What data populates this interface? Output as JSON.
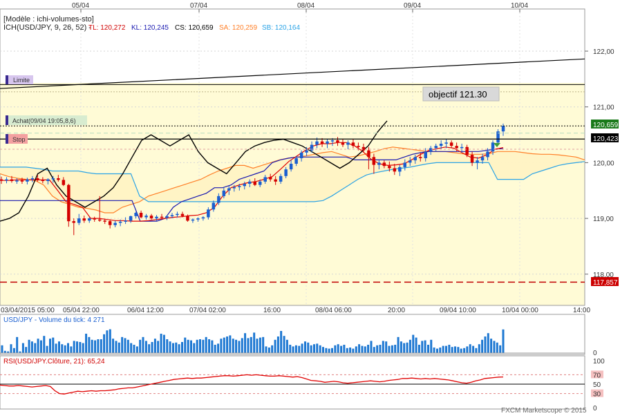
{
  "colors": {
    "background_main": "#fffbd6",
    "cloud_fill": "#fff3c4",
    "tenkan": "#e00000",
    "kijun": "#1818b0",
    "chikou": "#000000",
    "senkou_a": "#ff7f27",
    "senkou_b": "#2aa3e6",
    "candle_up": "#1a5fd0",
    "candle_down": "#d40000",
    "volume": "#1e78d2",
    "rsi": "#e00000",
    "stop_line": "#c00000"
  },
  "header": {
    "model_line": "[Modèle : ichi-volumes-sto]",
    "ich_label": "ICH(USD/JPY, 9, 26, 52) -",
    "tl": "TL: 120,272",
    "kl": "KL: 120,245",
    "cs": "CS: 120,659",
    "sa": "SA: 120,259",
    "sb": "SB: 120,164"
  },
  "top_dates": [
    "05/04",
    "07/04",
    "08/04",
    "09/04",
    "10/04"
  ],
  "bottom_axis": [
    "03/04/2015 05:00",
    "05/04 22:00",
    "06/04 12:00",
    "07/04 02:00",
    "16:00",
    "08/04 06:00",
    "20:00",
    "09/04 10:00",
    "10/04 00:00",
    "14:00"
  ],
  "price_axis": [
    "122,00",
    "121,00",
    "120,00",
    "119,00",
    "118,00"
  ],
  "badges": {
    "current": "120,659",
    "entry": "120,423",
    "stop": "117,857"
  },
  "markers": {
    "limit": "Limite",
    "buy": "Achat(09/04 19:05,8,6)",
    "stop": "Stop"
  },
  "annotation": "objectif 121.30",
  "volume_panel": {
    "title": "USD/JPY - Volume du tick: 4 271",
    "zero_label": "0"
  },
  "rsi_panel": {
    "title": "RSI(USD/JPY.Clôture, 21): 65,24",
    "axis": [
      "100",
      "70",
      "50",
      "30",
      "0"
    ]
  },
  "copyright": "FXCM Marketscope © 2015",
  "chart_data": [
    {
      "type": "candlestick",
      "title": "ICH(USD/JPY, 9, 26, 52)",
      "ylim": [
        117.6,
        122.7
      ],
      "ohlc": [
        [
          119.7,
          119.75,
          119.62,
          119.68
        ],
        [
          119.68,
          119.74,
          119.63,
          119.7
        ],
        [
          119.7,
          119.76,
          119.64,
          119.67
        ],
        [
          119.67,
          119.72,
          119.62,
          119.68
        ],
        [
          119.68,
          119.73,
          119.62,
          119.66
        ],
        [
          119.66,
          119.73,
          119.61,
          119.7
        ],
        [
          119.7,
          119.76,
          119.65,
          119.72
        ],
        [
          119.72,
          119.78,
          119.66,
          119.69
        ],
        [
          119.69,
          119.74,
          119.63,
          119.67
        ],
        [
          119.67,
          119.72,
          119.61,
          119.7
        ],
        [
          119.7,
          119.76,
          119.64,
          119.72
        ],
        [
          119.72,
          119.78,
          119.66,
          119.69
        ],
        [
          119.69,
          119.74,
          119.58,
          119.6
        ],
        [
          119.6,
          119.62,
          118.85,
          118.95
        ],
        [
          118.95,
          119.0,
          118.7,
          118.92
        ],
        [
          118.92,
          119.08,
          118.88,
          119.0
        ],
        [
          119.0,
          119.05,
          118.92,
          118.96
        ],
        [
          118.96,
          119.02,
          118.92,
          119.0
        ],
        [
          119.0,
          119.03,
          118.94,
          118.98
        ],
        [
          118.98,
          119.4,
          118.94,
          118.96
        ],
        [
          118.96,
          118.99,
          118.9,
          118.95
        ],
        [
          118.95,
          118.98,
          118.82,
          118.88
        ],
        [
          118.88,
          118.96,
          118.84,
          118.92
        ],
        [
          118.92,
          118.98,
          118.86,
          118.94
        ],
        [
          118.94,
          119.02,
          118.9,
          118.96
        ],
        [
          118.96,
          119.05,
          118.92,
          119.04
        ],
        [
          119.04,
          119.12,
          119.0,
          119.1
        ],
        [
          119.1,
          119.14,
          119.0,
          119.02
        ],
        [
          119.02,
          119.08,
          118.98,
          119.05
        ],
        [
          119.05,
          119.08,
          118.98,
          119.0
        ],
        [
          119.0,
          119.06,
          118.96,
          119.03
        ],
        [
          119.03,
          119.08,
          118.98,
          119.01
        ],
        [
          119.01,
          119.06,
          118.97,
          119.04
        ],
        [
          119.04,
          119.1,
          119.0,
          119.06
        ],
        [
          119.06,
          119.12,
          119.02,
          119.08
        ],
        [
          119.08,
          119.12,
          119.02,
          119.04
        ],
        [
          119.04,
          119.07,
          118.94,
          118.96
        ],
        [
          118.96,
          119.0,
          118.92,
          118.98
        ],
        [
          118.98,
          119.02,
          118.94,
          119.0
        ],
        [
          119.0,
          119.04,
          118.96,
          119.02
        ],
        [
          119.02,
          119.2,
          118.98,
          119.16
        ],
        [
          119.16,
          119.32,
          119.12,
          119.28
        ],
        [
          119.28,
          119.45,
          119.24,
          119.4
        ],
        [
          119.4,
          119.56,
          119.36,
          119.5
        ],
        [
          119.5,
          119.58,
          119.42,
          119.54
        ],
        [
          119.54,
          119.6,
          119.48,
          119.56
        ],
        [
          119.56,
          119.62,
          119.5,
          119.58
        ],
        [
          119.58,
          119.66,
          119.52,
          119.62
        ],
        [
          119.62,
          119.7,
          119.56,
          119.66
        ],
        [
          119.66,
          119.72,
          119.58,
          119.6
        ],
        [
          119.6,
          119.7,
          119.56,
          119.66
        ],
        [
          119.66,
          119.78,
          119.62,
          119.74
        ],
        [
          119.74,
          119.8,
          119.66,
          119.7
        ],
        [
          119.7,
          119.76,
          119.6,
          119.66
        ],
        [
          119.66,
          119.8,
          119.62,
          119.76
        ],
        [
          119.76,
          119.92,
          119.72,
          119.88
        ],
        [
          119.88,
          120.05,
          119.84,
          119.98
        ],
        [
          119.98,
          120.12,
          119.94,
          120.08
        ],
        [
          120.08,
          120.22,
          120.02,
          120.18
        ],
        [
          120.18,
          120.28,
          120.12,
          120.22
        ],
        [
          120.22,
          120.38,
          120.18,
          120.32
        ],
        [
          120.32,
          120.45,
          120.26,
          120.38
        ],
        [
          120.38,
          120.44,
          120.28,
          120.34
        ],
        [
          120.34,
          120.42,
          120.26,
          120.38
        ],
        [
          120.38,
          120.44,
          120.3,
          120.4
        ],
        [
          120.4,
          120.46,
          120.3,
          120.36
        ],
        [
          120.36,
          120.42,
          120.28,
          120.32
        ],
        [
          120.32,
          120.4,
          120.24,
          120.36
        ],
        [
          120.36,
          120.42,
          120.26,
          120.3
        ],
        [
          120.3,
          120.36,
          120.22,
          120.28
        ],
        [
          120.28,
          120.34,
          120.18,
          120.22
        ],
        [
          120.22,
          120.28,
          119.88,
          120.1
        ],
        [
          120.1,
          120.16,
          119.8,
          119.96
        ],
        [
          119.96,
          120.04,
          119.88,
          120.0
        ],
        [
          120.0,
          120.04,
          119.9,
          119.94
        ],
        [
          119.94,
          120.02,
          119.84,
          119.9
        ],
        [
          119.9,
          119.98,
          119.78,
          119.84
        ],
        [
          119.84,
          119.96,
          119.76,
          119.92
        ],
        [
          119.92,
          120.06,
          119.86,
          120.0
        ],
        [
          120.0,
          120.1,
          119.94,
          120.04
        ],
        [
          120.04,
          120.14,
          119.98,
          120.1
        ],
        [
          120.1,
          120.18,
          120.02,
          120.08
        ],
        [
          120.08,
          120.26,
          120.02,
          120.2
        ],
        [
          120.2,
          120.3,
          120.14,
          120.26
        ],
        [
          120.26,
          120.34,
          120.2,
          120.3
        ],
        [
          120.3,
          120.4,
          120.24,
          120.34
        ],
        [
          120.34,
          120.42,
          120.26,
          120.36
        ],
        [
          120.36,
          120.4,
          120.26,
          120.3
        ],
        [
          120.3,
          120.36,
          120.2,
          120.26
        ],
        [
          120.26,
          120.34,
          120.18,
          120.28
        ],
        [
          120.28,
          120.32,
          120.1,
          120.14
        ],
        [
          120.14,
          120.2,
          119.94,
          120.0
        ],
        [
          120.0,
          120.1,
          119.88,
          120.04
        ],
        [
          120.04,
          120.16,
          119.98,
          120.1
        ],
        [
          120.1,
          120.26,
          120.04,
          120.2
        ],
        [
          120.2,
          120.4,
          120.14,
          120.36
        ],
        [
          120.36,
          120.6,
          120.32,
          120.56
        ],
        [
          120.56,
          120.7,
          120.48,
          120.66
        ]
      ],
      "tenkan": [
        119.68,
        119.68,
        119.69,
        119.69,
        119.69,
        119.69,
        119.69,
        119.5,
        119.3,
        119.25,
        119.2,
        119.0,
        119.0,
        118.98,
        118.96,
        118.96,
        118.95,
        118.95,
        118.96,
        118.98,
        119.0,
        119.02,
        119.03,
        119.05,
        119.06,
        119.1,
        119.2,
        119.4,
        119.55,
        119.6,
        119.64,
        119.66,
        119.7,
        119.75,
        119.88,
        120.02,
        120.12,
        120.22,
        120.3,
        120.34,
        120.34,
        120.36,
        120.36,
        120.3,
        120.2,
        120.06,
        119.98,
        119.95,
        119.96,
        119.98,
        120.06,
        120.15,
        120.22,
        120.25,
        120.28,
        120.26,
        120.18,
        120.1,
        120.08,
        120.14,
        120.24,
        120.27
      ],
      "kijun": [
        119.32,
        119.32,
        119.32,
        119.32,
        119.32,
        119.32,
        119.32,
        119.32,
        119.32,
        119.32,
        119.32,
        119.32,
        119.32,
        119.32,
        119.32,
        119.32,
        119.32,
        118.95,
        118.95,
        118.95,
        119.0,
        119.2,
        119.3,
        119.35,
        119.4,
        119.45,
        119.55,
        119.55,
        119.6,
        119.7,
        119.75,
        119.8,
        119.85,
        120.0,
        120.05,
        120.08,
        120.1,
        120.1,
        120.1,
        120.1,
        120.1,
        120.1,
        120.1,
        120.05,
        120.05,
        120.05,
        120.05,
        120.05,
        120.05,
        120.1,
        120.15,
        120.18,
        120.2,
        120.2,
        120.2,
        120.2,
        120.2,
        120.2,
        120.2,
        120.22,
        120.24,
        120.25
      ],
      "chikou": [
        118.95,
        119.0,
        119.1,
        119.4,
        119.8,
        119.9,
        119.6,
        119.4,
        119.3,
        119.2,
        119.3,
        119.4,
        119.55,
        119.8,
        120.1,
        120.4,
        120.5,
        120.4,
        120.3,
        120.4,
        120.5,
        120.2,
        120.0,
        119.9,
        119.8,
        120.0,
        120.2,
        120.3,
        120.36,
        120.4,
        120.42,
        120.36,
        120.3,
        120.2,
        120.1,
        120.0,
        119.9,
        120.0,
        120.15,
        120.3,
        120.55,
        120.75
      ],
      "senkou_a": [
        119.8,
        119.75,
        119.72,
        119.7,
        119.68,
        119.6,
        119.4,
        119.3,
        119.25,
        119.2,
        119.18,
        119.15,
        119.1,
        119.1,
        119.2,
        119.25,
        119.3,
        119.4,
        119.45,
        119.5,
        119.55,
        119.6,
        119.65,
        119.7,
        119.78,
        119.85,
        119.9,
        119.95,
        119.95,
        119.9,
        119.95,
        120.0,
        120.05,
        120.08,
        120.1,
        120.12,
        120.15,
        120.18,
        120.2,
        120.15,
        120.1,
        120.12,
        120.16,
        120.2,
        120.25,
        120.28,
        120.26,
        120.24,
        120.22,
        120.2,
        120.2,
        120.2,
        120.18,
        120.16,
        120.15,
        120.15,
        120.16,
        120.2,
        120.2,
        120.2,
        120.18,
        120.16,
        120.15,
        120.15,
        120.14,
        120.12,
        120.1,
        120.05
      ],
      "senkou_b": [
        119.92,
        119.92,
        119.92,
        119.92,
        119.9,
        119.88,
        119.85,
        119.85,
        119.85,
        119.85,
        119.82,
        119.8,
        119.8,
        119.8,
        119.8,
        119.8,
        119.4,
        119.3,
        119.3,
        119.3,
        119.3,
        119.3,
        119.3,
        119.3,
        119.3,
        119.3,
        119.3,
        119.3,
        119.3,
        119.3,
        119.3,
        119.3,
        119.3,
        119.3,
        119.3,
        119.3,
        119.3,
        119.32,
        119.4,
        119.5,
        119.6,
        119.7,
        119.78,
        119.82,
        119.85,
        119.88,
        119.9,
        119.92,
        119.95,
        119.98,
        120.0,
        120.0,
        120.0,
        120.0,
        120.0,
        120.0,
        120.0,
        119.7,
        119.7,
        119.7,
        119.7,
        119.8,
        119.85,
        119.9,
        119.95,
        119.98,
        120.0,
        120.02
      ],
      "levels": {
        "limit": 121.4,
        "buy": 120.659,
        "entry": 120.423,
        "stop": 117.857,
        "objective": 121.3
      }
    },
    {
      "type": "bar",
      "title": "USD/JPY - Volume du tick: 4 271",
      "values": [
        1400,
        400,
        300,
        1600,
        900,
        2900,
        300,
        1800,
        1100,
        2400,
        2100,
        1800,
        2600,
        2300,
        3100,
        1300,
        2600,
        2800,
        1700,
        2100,
        1600,
        1400,
        1800,
        1200,
        2200,
        2100,
        2000,
        1800,
        3500,
        2900,
        2400,
        2300,
        2500,
        2500,
        3400,
        4100,
        4300,
        2600,
        2200,
        1900,
        2900,
        2700,
        2400,
        1800,
        1500,
        1200,
        2400,
        2900,
        2200,
        1600,
        2000,
        2600,
        2200,
        3500,
        3300,
        2500,
        2100,
        1800,
        1900,
        1600,
        2000,
        2800,
        2400,
        2300,
        1800,
        2400,
        2500,
        2400,
        2900,
        2500,
        2300,
        1500,
        1700,
        2600,
        2800,
        3000,
        3200,
        2600,
        2400,
        2200,
        2700,
        3600,
        2700,
        2900,
        3700,
        2600,
        2800,
        2900,
        1200,
        1000,
        1400,
        2400,
        3000,
        4000,
        3100,
        2400,
        1500,
        1200,
        1400,
        1300,
        1700,
        2100,
        1900,
        1400,
        1600,
        1700,
        1400,
        1100,
        900,
        800,
        900,
        1400,
        1600,
        1300,
        1500,
        900,
        1000,
        800,
        1200,
        1600,
        1300,
        1200,
        1500,
        2200,
        1100,
        1400,
        1500,
        2200,
        2100,
        1300,
        1400,
        1500,
        2900,
        2100,
        1800,
        1900,
        2400,
        3300,
        2800,
        1500,
        2200,
        2300,
        1500,
        2400,
        1000,
        800,
        1000,
        1300,
        1300,
        1500,
        1100,
        1200,
        1100,
        800,
        900,
        1200,
        1600,
        1300,
        900,
        1600,
        2400,
        3000,
        3600,
        2600,
        2200,
        1900,
        1400,
        4271
      ],
      "ylim": [
        0,
        6000
      ]
    },
    {
      "type": "line",
      "title": "RSI(USD/JPY.Clôture, 21): 65,24",
      "values": [
        48,
        47,
        46,
        46,
        47,
        46,
        45,
        44,
        45,
        46,
        47,
        45,
        36,
        30,
        29,
        31,
        33,
        35,
        34,
        35,
        36,
        35,
        36,
        36,
        37,
        38,
        40,
        41,
        42,
        42,
        44,
        46,
        48,
        50,
        52,
        54,
        56,
        58,
        60,
        61,
        62,
        63,
        62,
        63,
        63,
        64,
        65,
        66,
        67,
        68,
        68,
        67,
        68,
        69,
        70,
        69,
        70,
        69,
        68,
        67,
        67,
        68,
        67,
        66,
        65,
        66,
        64,
        61,
        58,
        57,
        56,
        54,
        55,
        56,
        55,
        53,
        52,
        53,
        54,
        55,
        56,
        57,
        56,
        55,
        56,
        58,
        59,
        60,
        62,
        62,
        63,
        62,
        61,
        62,
        61,
        62,
        61,
        60,
        59,
        57,
        55,
        53,
        52,
        54,
        57,
        59,
        62,
        63,
        64,
        65,
        65.24
      ],
      "ylim": [
        0,
        100
      ],
      "levels": [
        70,
        50,
        30
      ]
    }
  ]
}
